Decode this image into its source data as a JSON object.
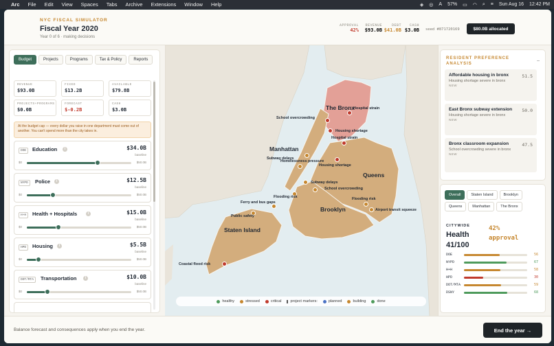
{
  "menubar": {
    "app": "Arc",
    "items": [
      "File",
      "Edit",
      "View",
      "Spaces",
      "Tabs",
      "Archive",
      "Extensions",
      "Window",
      "Help"
    ],
    "battery": "57%",
    "date": "Sun Aug 16",
    "time": "12:42 PM"
  },
  "header": {
    "eyebrow": "NYC FISCAL SIMULATOR",
    "title": "Fiscal Year 2020",
    "subtitle": "Year 0 of 6 · making decisions",
    "stats": [
      {
        "label": "APPROVAL",
        "value": "42%",
        "color": "#c0392b"
      },
      {
        "label": "REVENUE",
        "value": "$93.0B",
        "color": "#1d2530"
      },
      {
        "label": "DEBT",
        "value": "$41.0B",
        "color": "#c6872f"
      },
      {
        "label": "CASH",
        "value": "$3.0B",
        "color": "#1d2530"
      }
    ],
    "seed": "seed #871720169",
    "allocated_label": "$80.0B allocated"
  },
  "left": {
    "tabs": [
      "Budget",
      "Projects",
      "Programs",
      "Tax & Policy",
      "Reports"
    ],
    "metrics": [
      {
        "label": "REVENUE",
        "value": "$93.0B"
      },
      {
        "label": "FIXED",
        "value": "$13.2B"
      },
      {
        "label": "AVAILABLE",
        "value": "$79.8B"
      },
      {
        "label": "PROJECTS+PROGRAMS",
        "value": "$0.0B"
      },
      {
        "label": "FORECAST",
        "value": "$-0.2B"
      },
      {
        "label": "CASH",
        "value": "$3.0B"
      }
    ],
    "warning": "At the budget cap — every dollar you raise in one department must come out of another. You can't spend more than the city takes in.",
    "departments": [
      {
        "tag": "DOE",
        "name": "Education",
        "amount": "$34.0B",
        "baseline": "baseline",
        "min": "$0",
        "max": "$50.0B",
        "level": 0.68
      },
      {
        "tag": "NYPD",
        "name": "Police",
        "amount": "$12.5B",
        "baseline": "baseline",
        "min": "$0",
        "max": "$50.0B",
        "level": 0.25
      },
      {
        "tag": "H+H",
        "name": "Health + Hospitals",
        "amount": "$15.0B",
        "baseline": "baseline",
        "min": "$0",
        "max": "$50.0B",
        "level": 0.3
      },
      {
        "tag": "HPD",
        "name": "Housing",
        "amount": "$5.5B",
        "baseline": "baseline",
        "min": "$0",
        "max": "$50.0B",
        "level": 0.11
      },
      {
        "tag": "DOT/MTA",
        "name": "Transportation",
        "amount": "$10.0B",
        "baseline": "baseline",
        "min": "$0",
        "max": "$50.0B",
        "level": 0.2
      }
    ]
  },
  "map": {
    "boroughs": [
      "The Bronx",
      "Manhattan",
      "Queens",
      "Brooklyn",
      "Staten Island"
    ],
    "markers": [
      {
        "label": "Hospital strain",
        "status": "critical"
      },
      {
        "label": "School overcrowding",
        "status": "critical"
      },
      {
        "label": "Housing shortage",
        "status": "critical"
      },
      {
        "label": "Hospital strain",
        "status": "critical"
      },
      {
        "label": "Subway delays",
        "status": "stressed"
      },
      {
        "label": "Housing shortage",
        "status": "critical"
      },
      {
        "label": "Homelessness pressure",
        "status": "stressed"
      },
      {
        "label": "Subway delays",
        "status": "stressed"
      },
      {
        "label": "School overcrowding",
        "status": "stressed"
      },
      {
        "label": "Flooding risk",
        "status": "stressed"
      },
      {
        "label": "Flooding risk",
        "status": "stressed"
      },
      {
        "label": "Ferry and bus gaps",
        "status": "stressed"
      },
      {
        "label": "Public safety",
        "status": "stressed"
      },
      {
        "label": "Airport transit squeeze",
        "status": "stressed"
      },
      {
        "label": "Coastal flood risk",
        "status": "critical"
      }
    ],
    "legend": {
      "healthy": "healthy",
      "stressed": "stressed",
      "critical": "critical",
      "project_markers": "project markers:",
      "planned": "planned",
      "building": "building",
      "done": "done"
    },
    "colors": {
      "healthy": "#4e9a5b",
      "stressed": "#c6872f",
      "critical": "#c0392b",
      "planned": "#4a72c4",
      "building": "#c6872f",
      "done": "#4e9a5b"
    }
  },
  "preferences": {
    "title": "RESIDENT PREFERENCE ANALYSIS",
    "collapse": "–",
    "items": [
      {
        "title": "Affordable housing in bronx",
        "score": "51.5",
        "sub": "Housing shortage severe in bronx",
        "tag": "NEW"
      },
      {
        "title": "East Bronx subway extension",
        "score": "50.0",
        "sub": "Housing shortage severe in bronx",
        "tag": "NEW"
      },
      {
        "title": "Bronx classroom expansion",
        "score": "47.5",
        "sub": "School overcrowding severe in bronx",
        "tag": "NEW"
      }
    ]
  },
  "citywide": {
    "tabs": [
      "Overall",
      "Staten Island",
      "Brooklyn",
      "Queens",
      "Manhattan",
      "The Bronx"
    ],
    "label": "CITYWIDE",
    "health_word": "Health",
    "health_value": "41/100",
    "approval_value": "42%",
    "approval_word": "approval",
    "metrics": [
      {
        "label": "DOE",
        "value": "56",
        "color": "#c6872f",
        "fraction": 0.56
      },
      {
        "label": "NYPD",
        "value": "67",
        "color": "#4e9a5b",
        "fraction": 0.67
      },
      {
        "label": "H+H",
        "value": "58",
        "color": "#c6872f",
        "fraction": 0.58
      },
      {
        "label": "HPD",
        "value": "30",
        "color": "#c0392b",
        "fraction": 0.3
      },
      {
        "label": "DOT/MTA",
        "value": "59",
        "color": "#c6872f",
        "fraction": 0.59
      },
      {
        "label": "DSNY",
        "value": "68",
        "color": "#4e9a5b",
        "fraction": 0.68
      }
    ]
  },
  "footer": {
    "note": "Balance forecast and consequences apply when you end the year.",
    "end_label": "End the year →"
  }
}
